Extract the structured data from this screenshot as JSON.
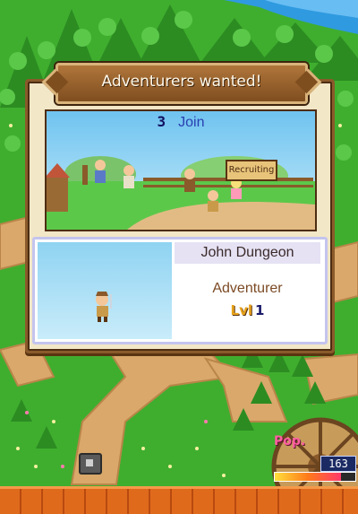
{
  "popup": {
    "title": "Adventurers wanted!",
    "join_count": "3",
    "join_label": "Join",
    "sign_text": "Recruiting"
  },
  "candidate": {
    "name": "John Dungeon",
    "job": "Adventurer",
    "level_tag": "Lvl",
    "level": "1"
  },
  "hud": {
    "pop_label": "Pop.",
    "pop_value": "163",
    "pop_fill_fraction": 0.82
  },
  "colors": {
    "grass": "#3fae2e",
    "path": "#d9a86a",
    "panel_border": "#8a5a2b",
    "title_text": "#fff8e8",
    "join_text": "#2a3fb0",
    "job_text": "#7b4a24"
  },
  "icons": [
    "stone-marker-icon",
    "wheel-icon"
  ]
}
